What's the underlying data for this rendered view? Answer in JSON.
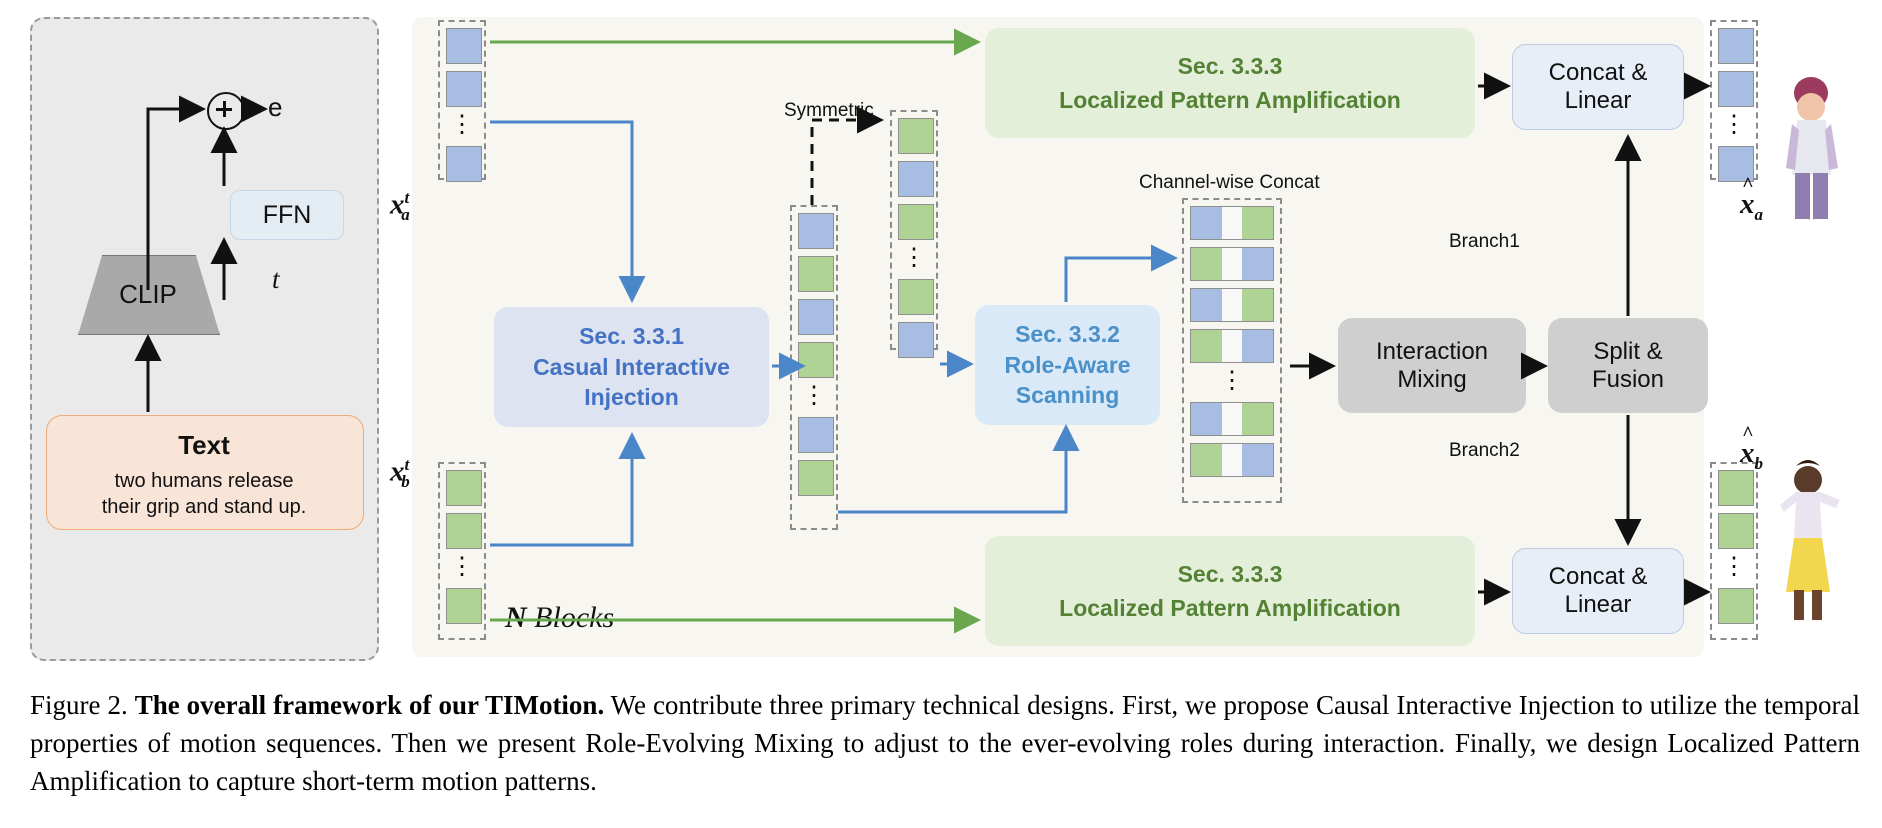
{
  "figure": {
    "number": "Figure 2.",
    "title_bold": "The overall framework of our TIMotion.",
    "body": " We contribute three primary technical designs. First, we propose Causal Interactive Injection to utilize the temporal properties of motion sequences. Then we present Role-Evolving Mixing to adjust to the ever-evolving roles during interaction. Finally, we design Localized Pattern Amplification to capture short-term motion patterns."
  },
  "left_panel": {
    "ffn_label": "FFN",
    "clip_label": "CLIP",
    "plus_symbol": "+",
    "output_label": "e",
    "timestep_label": "t",
    "text_title": "Text",
    "text_line1": "two humans release",
    "text_line2": "their grip and stand up."
  },
  "main": {
    "input_a_label": "x",
    "input_b_label": "x",
    "blocks_label_bold": "N",
    "blocks_label_rest": " Blocks",
    "symmetric_label": "Symmetric",
    "channel_concat_label": "Channel-wise Concat",
    "branch1_label": "Branch1",
    "branch2_label": "Branch2",
    "sec331": {
      "sec": "Sec. 3.3.1",
      "line1": "Casual Interactive",
      "line2": "Injection"
    },
    "sec332": {
      "sec": "Sec. 3.3.2",
      "line1": "Role-Aware",
      "line2": "Scanning"
    },
    "sec333_top": {
      "sec": "Sec. 3.3.3",
      "line1": "Localized Pattern Amplification"
    },
    "sec333_bottom": {
      "sec": "Sec. 3.3.3",
      "line1": "Localized Pattern Amplification"
    },
    "interaction_mixing": {
      "line1": "Interaction",
      "line2": "Mixing"
    },
    "split_fusion": {
      "line1": "Split &",
      "line2": "Fusion"
    },
    "concat_linear_top": {
      "line1": "Concat &",
      "line2": "Linear"
    },
    "concat_linear_bottom": {
      "line1": "Concat &",
      "line2": "Linear"
    },
    "output_a_label": "x",
    "output_b_label": "x",
    "vertical_dots": "⋮"
  },
  "colors": {
    "blue_token": "#a8bde2",
    "green_token": "#aed395",
    "blue_accent": "#4472c4",
    "light_blue_accent": "#4a90c9",
    "green_accent": "#548235",
    "panel_bg": "#f7f6f1",
    "left_panel_bg": "#eaeaea",
    "text_box_bg": "#f8e5d7",
    "grey_box": "#cfcfcf"
  }
}
